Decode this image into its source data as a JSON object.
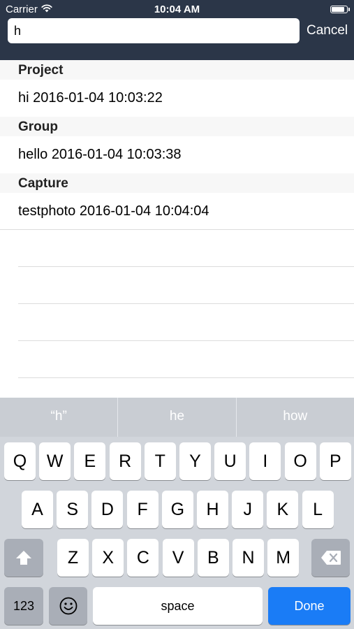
{
  "status_bar": {
    "carrier": "Carrier",
    "time": "10:04 AM",
    "battery_level": 0.9,
    "wifi_icon": "wifi-icon",
    "battery_icon": "battery-icon"
  },
  "search": {
    "value": "h",
    "cancel_label": "Cancel"
  },
  "sections": [
    {
      "header": "Project",
      "rows": [
        "hi  2016-01-04 10:03:22"
      ]
    },
    {
      "header": "Group",
      "rows": [
        "hello  2016-01-04 10:03:38"
      ]
    },
    {
      "header": "Capture",
      "rows": [
        "testphoto  2016-01-04 10:04:04"
      ]
    }
  ],
  "keyboard": {
    "suggestions": [
      "“h”",
      "he",
      "how"
    ],
    "row1": [
      "Q",
      "W",
      "E",
      "R",
      "T",
      "Y",
      "U",
      "I",
      "O",
      "P"
    ],
    "row2": [
      "A",
      "S",
      "D",
      "F",
      "G",
      "H",
      "J",
      "K",
      "L"
    ],
    "row3": [
      "Z",
      "X",
      "C",
      "V",
      "B",
      "N",
      "M"
    ],
    "numbers_label": "123",
    "space_label": "space",
    "done_label": "Done",
    "shift_icon": "shift-icon",
    "delete_icon": "delete-icon",
    "emoji_icon": "emoji-icon"
  },
  "colors": {
    "navbar": "#2b3648",
    "done_key": "#1a7cf6",
    "keyboard_bg": "#d1d5db"
  }
}
